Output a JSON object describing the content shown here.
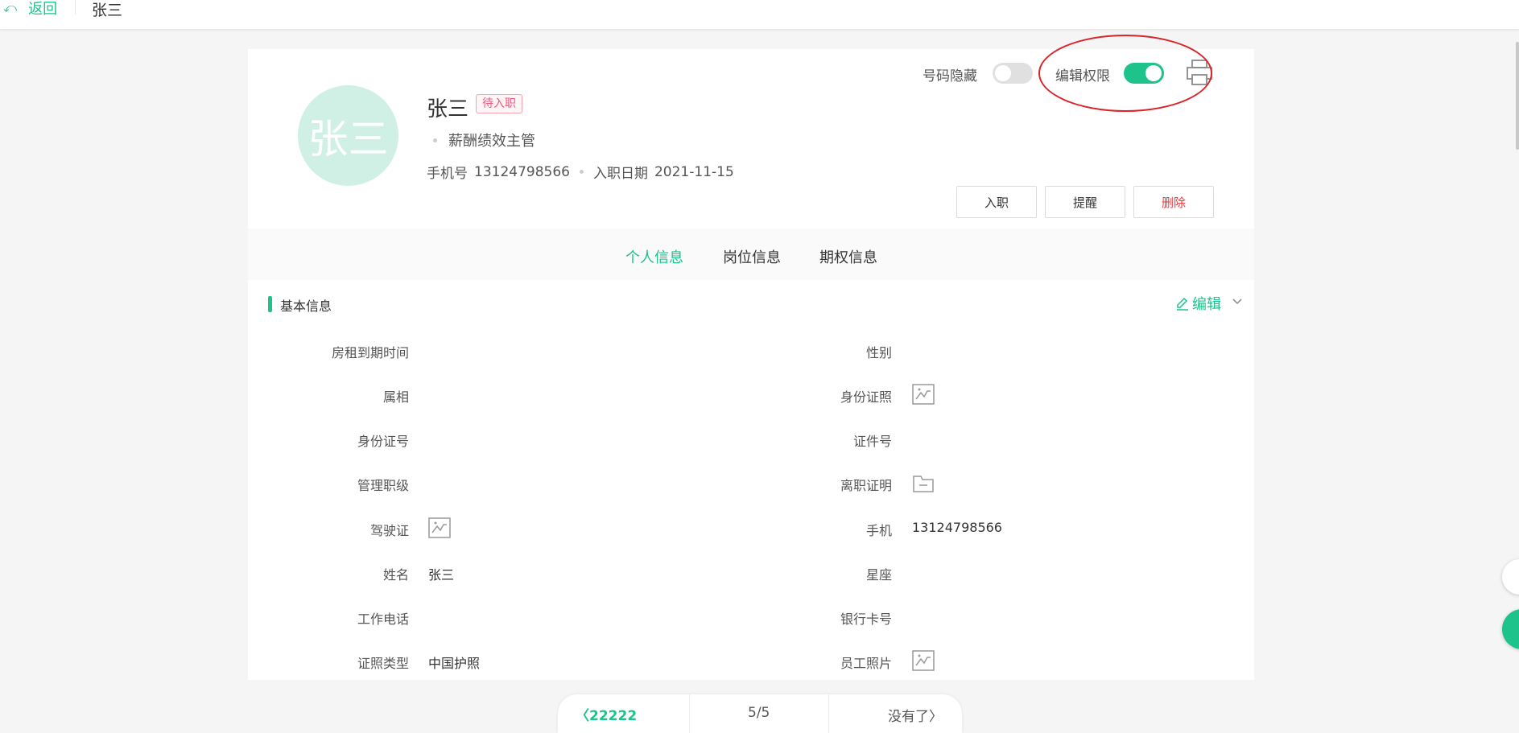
{
  "topbar": {
    "back_label": "返回",
    "title": "张三"
  },
  "profile": {
    "avatar_text": "张三",
    "name": "张三",
    "status": "待入职",
    "position": "薪酬绩效主管",
    "phone_label": "手机号",
    "phone": "13124798566",
    "hire_label": "入职日期",
    "hire_date": "2021-11-15",
    "switches": {
      "hide_number": {
        "label": "号码隐藏",
        "on": false
      },
      "edit_permission": {
        "label": "编辑权限",
        "on": true
      }
    },
    "buttons": {
      "onboard": "入职",
      "remind": "提醒",
      "delete": "删除"
    }
  },
  "tabs": [
    "个人信息",
    "岗位信息",
    "期权信息"
  ],
  "active_tab": 0,
  "section": {
    "title": "基本信息",
    "edit_label": "编辑",
    "fields_left": [
      {
        "label": "房租到期时间",
        "value": ""
      },
      {
        "label": "属相",
        "value": ""
      },
      {
        "label": "身份证号",
        "value": ""
      },
      {
        "label": "管理职级",
        "value": ""
      },
      {
        "label": "驾驶证",
        "value": "",
        "icon": "image-icon"
      },
      {
        "label": "姓名",
        "value": "张三"
      },
      {
        "label": "工作电话",
        "value": ""
      },
      {
        "label": "证照类型",
        "value": "中国护照"
      }
    ],
    "fields_right": [
      {
        "label": "性别",
        "value": ""
      },
      {
        "label": "身份证照",
        "value": "",
        "icon": "image-icon"
      },
      {
        "label": "证件号",
        "value": ""
      },
      {
        "label": "离职证明",
        "value": "",
        "icon": "folder-icon"
      },
      {
        "label": "手机",
        "value": "13124798566"
      },
      {
        "label": "星座",
        "value": ""
      },
      {
        "label": "银行卡号",
        "value": ""
      },
      {
        "label": "员工照片",
        "value": "",
        "icon": "image-icon"
      }
    ]
  },
  "pager": {
    "prev": "22222",
    "count": "5/5",
    "next": "没有了"
  },
  "colors": {
    "accent": "#1ec28b",
    "danger": "#f0363c",
    "annotation": "#d9252a"
  }
}
